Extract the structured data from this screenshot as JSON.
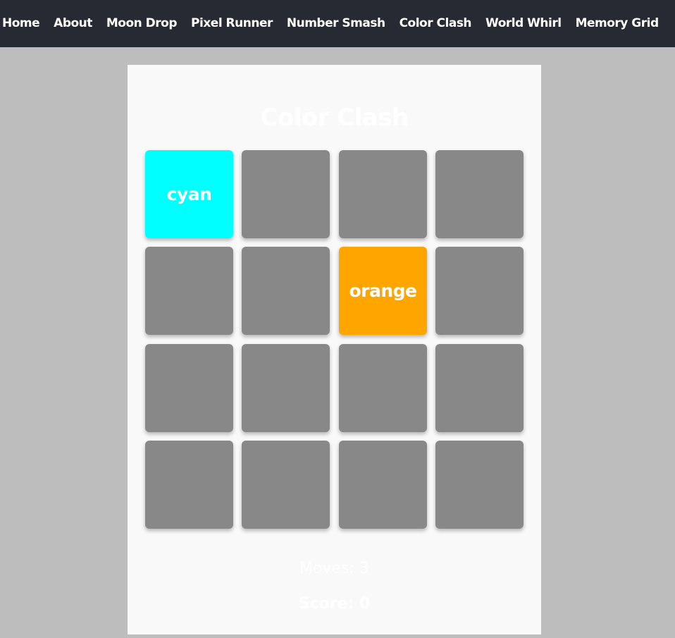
{
  "nav": {
    "links": [
      "Home",
      "About",
      "Moon Drop",
      "Pixel Runner",
      "Number Smash",
      "Color Clash",
      "World Whirl",
      "Memory Grid"
    ]
  },
  "game": {
    "title": "Color Clash",
    "tiles": [
      {
        "revealed": true,
        "color": "#00ffff",
        "label": "cyan"
      },
      {
        "revealed": false,
        "color": "#888888",
        "label": ""
      },
      {
        "revealed": false,
        "color": "#888888",
        "label": ""
      },
      {
        "revealed": false,
        "color": "#888888",
        "label": ""
      },
      {
        "revealed": false,
        "color": "#888888",
        "label": ""
      },
      {
        "revealed": false,
        "color": "#888888",
        "label": ""
      },
      {
        "revealed": true,
        "color": "#ffa500",
        "label": "orange"
      },
      {
        "revealed": false,
        "color": "#888888",
        "label": ""
      },
      {
        "revealed": false,
        "color": "#888888",
        "label": ""
      },
      {
        "revealed": false,
        "color": "#888888",
        "label": ""
      },
      {
        "revealed": false,
        "color": "#888888",
        "label": ""
      },
      {
        "revealed": false,
        "color": "#888888",
        "label": ""
      },
      {
        "revealed": false,
        "color": "#888888",
        "label": ""
      },
      {
        "revealed": false,
        "color": "#888888",
        "label": ""
      },
      {
        "revealed": false,
        "color": "#888888",
        "label": ""
      },
      {
        "revealed": false,
        "color": "#888888",
        "label": ""
      }
    ],
    "moves_text": "Moves: 3",
    "score_text": "Score: 0"
  },
  "colors": {
    "nav_background": "#272a33",
    "page_background": "#bdbdbd",
    "card_background": "#f9f9f9",
    "hidden_tile": "#888888"
  }
}
